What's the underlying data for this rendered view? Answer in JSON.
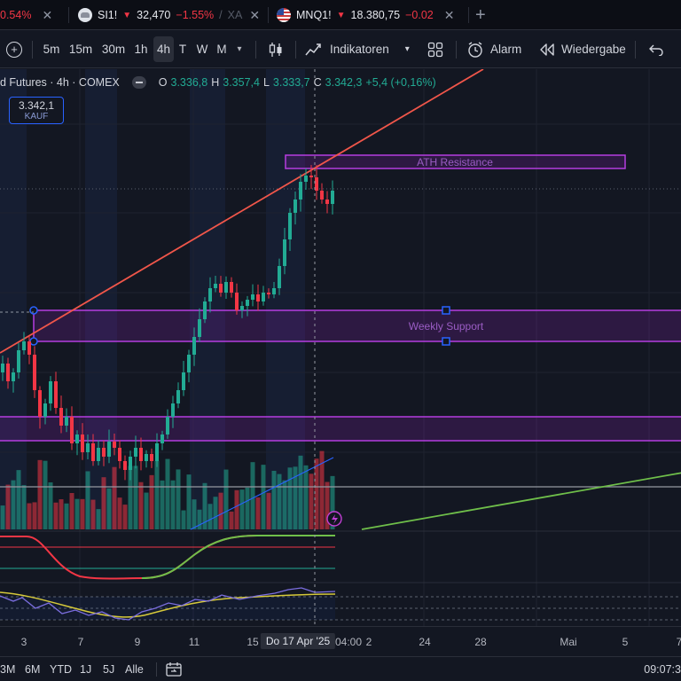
{
  "tabs": [
    {
      "change_pct": "0.54%"
    },
    {
      "symbol": "SI1!",
      "price": "32,470",
      "change": "−1.55%",
      "sep": "/",
      "trail": "XA"
    },
    {
      "symbol": "MNQ1!",
      "price": "18.380,75",
      "change": "−0.02"
    }
  ],
  "icons": {
    "close": "close-icon",
    "new_tab": "plus-icon",
    "down": "down-triangle-icon"
  },
  "toolbar": {
    "intervals": [
      "5m",
      "15m",
      "30m",
      "1h",
      "4h",
      "T",
      "W",
      "M"
    ],
    "active_interval": "4h",
    "indicators_label": "Indikatoren",
    "alarm_label": "Alarm",
    "replay_label": "Wiedergabe"
  },
  "legend": {
    "title": "d Futures · 4h · COMEX",
    "open_key": "O",
    "open": "3.336,8",
    "high_key": "H",
    "high": "3.357,4",
    "low_key": "L",
    "low": "3.333,7",
    "close_key": "C",
    "close": "3.342,3",
    "change": "+5,4 (+0,16%)"
  },
  "buy_button": {
    "price": "3.342,1",
    "label": "KAUF"
  },
  "annotations": {
    "ath": "ATH Resistance",
    "weekly": "Weekly Support"
  },
  "colors": {
    "bg": "#131722",
    "up": "#22ab94",
    "down": "#f23645",
    "zone": "#9c27b0",
    "trend_red": "#f0564a",
    "trend_green": "#6fbf4a",
    "volume_trend": "#2962ff"
  },
  "time_axis": {
    "labels": [
      "3",
      "7",
      "9",
      "11",
      "15",
      "Do 17 Apr '25",
      "04:00",
      "2",
      "24",
      "28",
      "Mai",
      "5",
      "7"
    ],
    "crosshair_label": "Do 17 Apr '25",
    "crosshair_time": "04:00"
  },
  "bottom": {
    "ranges": [
      "3M",
      "6M",
      "YTD",
      "1J",
      "5J",
      "Alle"
    ],
    "clock": "09:07:3"
  },
  "chart_data": {
    "type": "candlestick",
    "interval": "4h",
    "last_close": 3342.3,
    "ohlc_last": {
      "open": 3336.8,
      "high": 3357.4,
      "low": 3333.7,
      "close": 3342.3
    }
  }
}
